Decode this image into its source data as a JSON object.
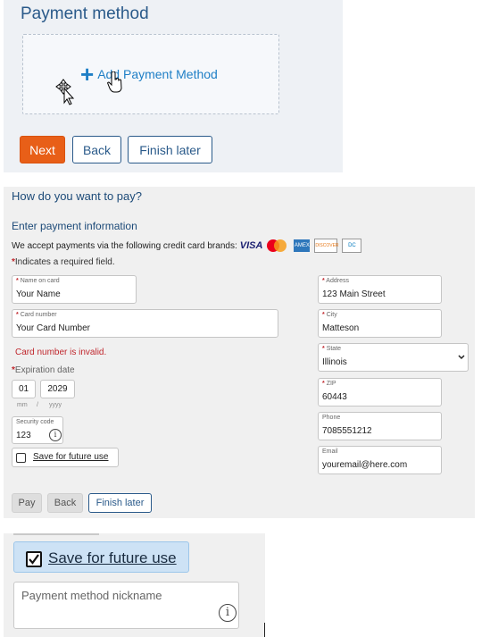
{
  "section1": {
    "title": "Payment method",
    "add_payment_method_label": "Add Payment Method",
    "buttons": {
      "next": "Next",
      "back": "Back",
      "finish_later": "Finish later"
    },
    "colors": {
      "accent": "#e85f18",
      "link": "#1f7fc6",
      "heading": "#2a5a8a"
    }
  },
  "section2": {
    "question": "How do you want to pay?",
    "subheading": "Enter payment information",
    "accept_text": "We accept payments via the following credit card brands:",
    "card_brands": [
      "VISA",
      "Mastercard",
      "American Express",
      "Discover",
      "Diners Club"
    ],
    "required_note": "Indicates a required field.",
    "required_marker": "*",
    "fields": {
      "name_on_card": {
        "label": "Name on card",
        "value": "Your Name"
      },
      "card_number": {
        "label": "Card number",
        "value": "Your Card Number"
      },
      "address": {
        "label": "Address",
        "value": "123 Main Street"
      },
      "city": {
        "label": "City",
        "value": "Matteson"
      },
      "state": {
        "label": "State",
        "value": "Illinois"
      },
      "zip": {
        "label": "ZIP",
        "value": "60443"
      },
      "phone": {
        "label": "Phone",
        "value": "7085551212"
      },
      "email": {
        "label": "Email",
        "value": "youremail@here.com"
      }
    },
    "card_error": "Card number is invalid.",
    "expiration": {
      "label": "Expiration date",
      "month": "01",
      "year": "2029",
      "month_hint": "mm",
      "sep": "/",
      "year_hint": "yyyy"
    },
    "security_code": {
      "label": "Security code",
      "value": "123"
    },
    "save_for_future": "Save for future use",
    "buttons": {
      "pay": "Pay",
      "back": "Back",
      "finish_later": "Finish later"
    }
  },
  "section3": {
    "save_for_future": "Save for future use",
    "save_checked": true,
    "nickname_placeholder": "Payment method nickname"
  }
}
